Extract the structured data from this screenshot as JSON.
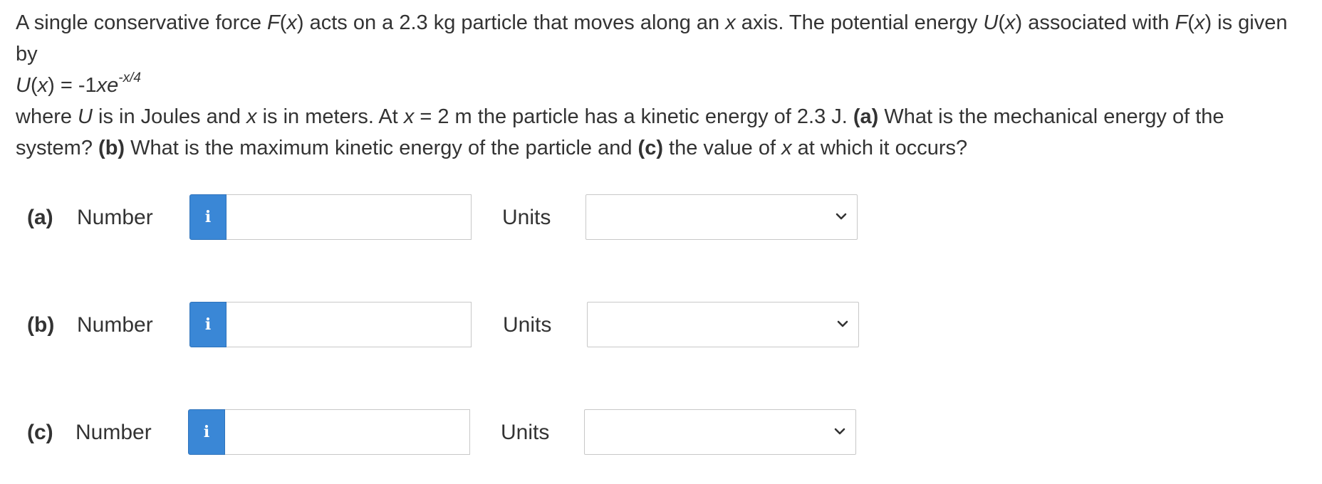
{
  "question": {
    "line1_a": "A single conservative force ",
    "line1_fx": "F",
    "line1_b": "(",
    "line1_x": "x",
    "line1_c": ") acts on a 2.3 kg particle that moves along an ",
    "line1_x2": "x",
    "line1_d": " axis. The potential energy ",
    "line1_u": "U",
    "line1_e": "(",
    "line1_x3": "x",
    "line1_f": ") associated with ",
    "line1_f2": "F",
    "line1_g": "(",
    "line1_x4": "x",
    "line1_h": ") is given by",
    "eq_u": "U",
    "eq_open": "(",
    "eq_x": "x",
    "eq_mid": ") = -1",
    "eq_xe": "xe",
    "eq_exp": "-x/4",
    "where_a": "where ",
    "where_u": "U",
    "where_b": " is in Joules and ",
    "where_x": "x",
    "where_c": " is in meters. At ",
    "where_x2": "x",
    "where_d": " = 2 m the particle has a kinetic energy of 2.3 J. ",
    "part_a_tag": "(a)",
    "part_a_text": " What is the mechanical energy of the system? ",
    "part_b_tag": "(b)",
    "part_b_text": " What is the maximum kinetic energy of the particle and ",
    "part_c_tag": "(c)",
    "part_c_text": " the value of ",
    "part_c_x": "x",
    "part_c_end": " at which it occurs?"
  },
  "answers": [
    {
      "part": "(a)",
      "number_label": "Number",
      "info_icon": "i",
      "number_value": "",
      "units_label": "Units",
      "units_value": ""
    },
    {
      "part": "(b)",
      "number_label": "Number",
      "info_icon": "i",
      "number_value": "",
      "units_label": "Units",
      "units_value": ""
    },
    {
      "part": "(c)",
      "number_label": "Number",
      "info_icon": "i",
      "number_value": "",
      "units_label": "Units",
      "units_value": ""
    }
  ],
  "colors": {
    "info_button": "#3a87d6",
    "text": "#333333",
    "border": "#c8c8c8"
  },
  "icons": {
    "info": "info-icon",
    "select": "chevron-down-icon"
  }
}
